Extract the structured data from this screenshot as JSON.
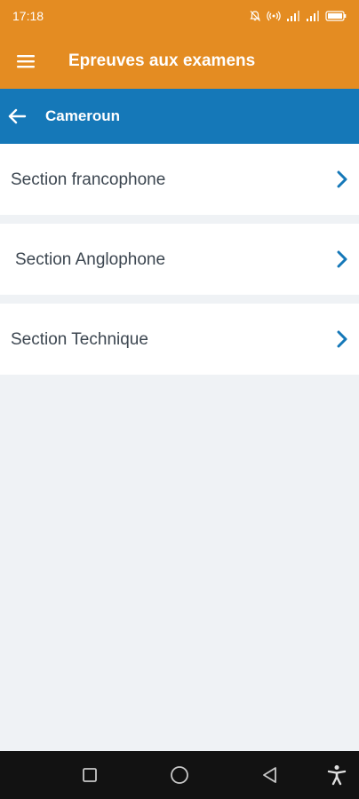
{
  "status_bar": {
    "time": "17:18",
    "icons": [
      "mute-notifications-icon",
      "hotspot-icon",
      "signal-icon",
      "signal-icon",
      "battery-icon"
    ]
  },
  "app_bar": {
    "title": "Epreuves aux examens",
    "menu_icon": "hamburger-menu-icon"
  },
  "sub_header": {
    "title": "Cameroun",
    "back_icon": "arrow-left-icon"
  },
  "sections": [
    {
      "label": "Section francophone",
      "icon": "chevron-right-icon"
    },
    {
      "label": "Section Anglophone",
      "icon": "chevron-right-icon"
    },
    {
      "label": "Section Technique",
      "icon": "chevron-right-icon"
    }
  ],
  "nav_bar": {
    "icons": [
      "recent-apps-icon",
      "home-icon",
      "back-icon",
      "accessibility-icon"
    ]
  },
  "colors": {
    "app_bar": "#e48c22",
    "sub_header": "#1578b8",
    "chevron": "#1578b8",
    "background": "#eff2f5",
    "item_text": "#3c4650",
    "nav_bar": "#121212"
  }
}
